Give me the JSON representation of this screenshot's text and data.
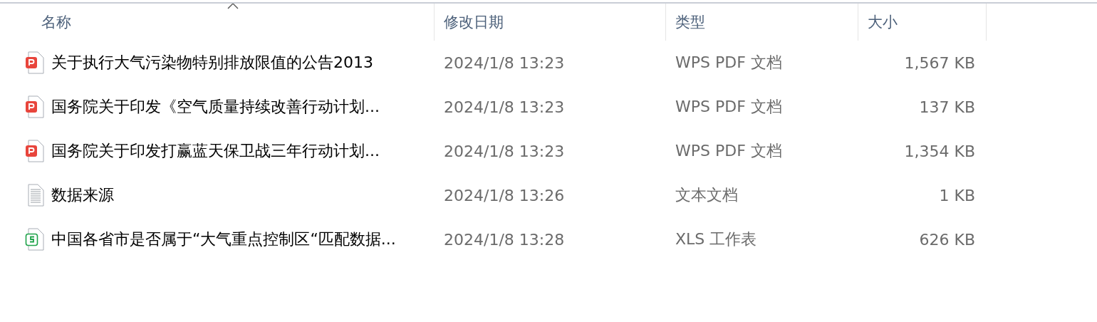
{
  "table": {
    "columns": [
      {
        "label": "名称",
        "sorted": true
      },
      {
        "label": "修改日期",
        "sorted": false
      },
      {
        "label": "类型",
        "sorted": false
      },
      {
        "label": "大小",
        "sorted": false
      }
    ],
    "rows": [
      {
        "kind": "pdf",
        "name": "关于执行大气污染物特别排放限值的公告2013",
        "modified": "2024/1/8 13:23",
        "type": "WPS PDF 文档",
        "size": "1,567 KB"
      },
      {
        "kind": "pdf",
        "name": "国务院关于印发《空气质量持续改善行动计划...",
        "modified": "2024/1/8 13:23",
        "type": "WPS PDF 文档",
        "size": "137 KB"
      },
      {
        "kind": "pdf",
        "name": "国务院关于印发打赢蓝天保卫战三年行动计划...",
        "modified": "2024/1/8 13:23",
        "type": "WPS PDF 文档",
        "size": "1,354 KB"
      },
      {
        "kind": "text",
        "name": "数据来源",
        "modified": "2024/1/8 13:26",
        "type": "文本文档",
        "size": "1 KB"
      },
      {
        "kind": "sheet",
        "name": "中国各省市是否属于“大气重点控制区“匹配数据...",
        "modified": "2024/1/8 13:28",
        "type": "XLS 工作表",
        "size": "626 KB"
      }
    ]
  }
}
